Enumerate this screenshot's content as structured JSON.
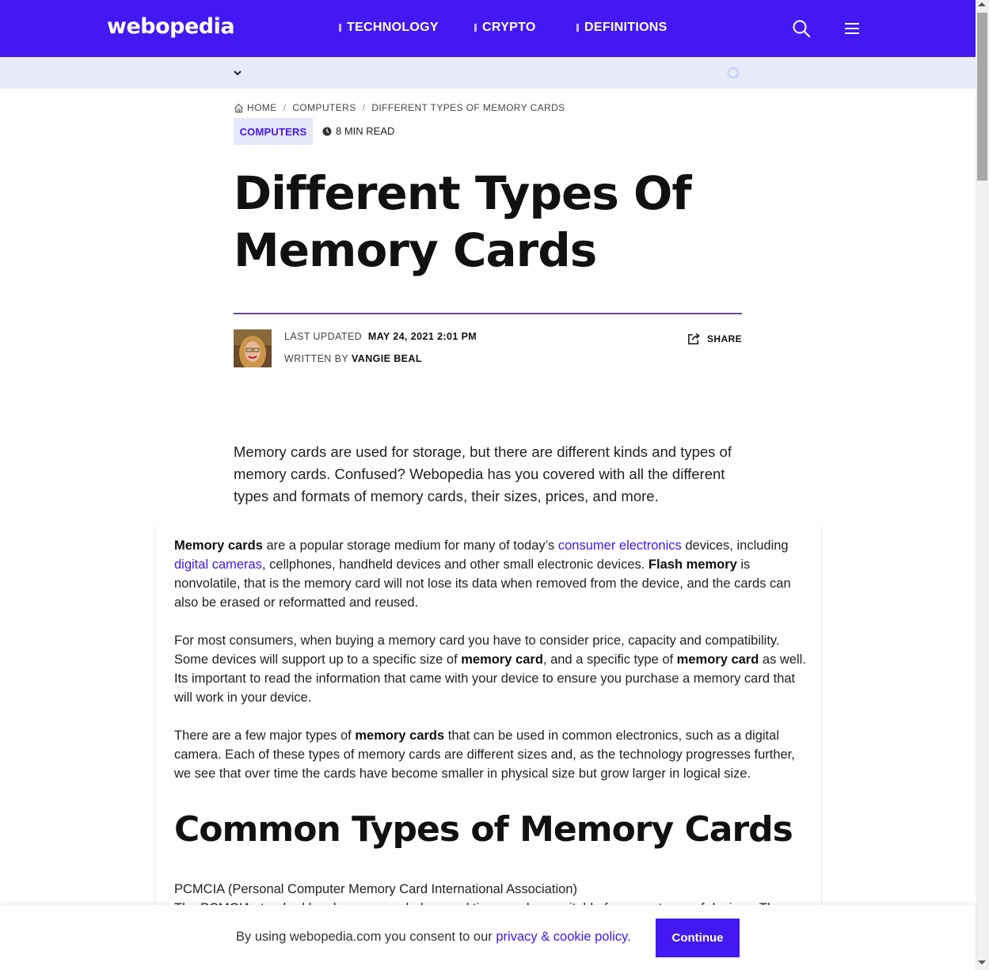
{
  "nav": {
    "logo": "webopedia",
    "links": [
      "TECHNOLOGY",
      "CRYPTO",
      "DEFINITIONS"
    ]
  },
  "breadcrumb": {
    "home": "HOME",
    "category": "COMPUTERS",
    "current": "DIFFERENT TYPES OF MEMORY CARDS"
  },
  "article": {
    "category": "COMPUTERS",
    "read_time": "8 MIN READ",
    "title": "Different Types Of Memory Cards",
    "updated_label": "LAST UPDATED",
    "updated_value": "MAY 24, 2021 2:01 PM",
    "written_label": "WRITTEN BY",
    "author": "VANGIE BEAL",
    "share_label": "SHARE",
    "lede": "Memory cards are used for storage, but there are different kinds and types of memory cards. Confused? Webopedia has you covered with all the different types and formats of memory cards, their sizes, prices, and more."
  },
  "body": {
    "p1": {
      "t1": "Memory cards",
      "t2": " are a popular storage medium for many of today’s ",
      "link1": "consumer electronics",
      "t3": " devices, including ",
      "link2": "digital cameras",
      "t4": ", cellphones, handheld devices and other small electronic devices. ",
      "t5": "Flash memory",
      "t6": " is nonvolatile, that is the memory card will not lose its data when removed from the device, and the cards can also be erased or reformatted and reused."
    },
    "p2": {
      "t1": "For most consumers, when buying a memory card you have to consider price, capacity and compatibility. Some devices will support up to a specific size of ",
      "t2": "memory card",
      "t3": ", and a specific type of ",
      "t4": "memory card",
      "t5": " as well. Its important to read the information that came with your device to ensure you purchase a memory card that will work in your device."
    },
    "p3": {
      "t1": "There are a few major types of ",
      "t2": "memory cards",
      "t3": " that can be used in common electronics, such as a digital camera. Each of these types of memory cards are different sizes and, as the technology progresses further, we see that over time the cards have become smaller in physical size but grow larger in logical size."
    },
    "heading": "Common Types of Memory Cards",
    "p4_line1": "PCMCIA (Personal Computer Memory Card International Association)",
    "p4_line2": "The PCMCIA standard has been expanded several times and are suitable for many types of devices. There"
  },
  "cookie": {
    "text_before": "By using webopedia.com you consent to our ",
    "link": "privacy & cookie policy",
    "text_after": ".",
    "button": "Continue"
  },
  "colors": {
    "brand": "#4318f2",
    "subbar": "#e9ebfa",
    "badge_bg": "#e6e8f9"
  }
}
